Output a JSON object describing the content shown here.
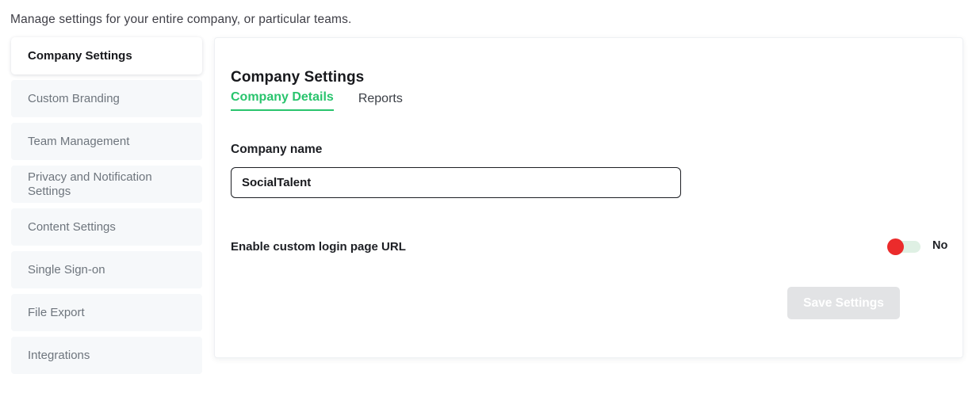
{
  "page": {
    "intro": "Manage settings for your entire company, or particular teams."
  },
  "sidebar": {
    "items": [
      {
        "label": "Company Settings",
        "active": true
      },
      {
        "label": "Custom Branding",
        "active": false
      },
      {
        "label": "Team Management",
        "active": false
      },
      {
        "label": "Privacy and Notification Settings",
        "active": false
      },
      {
        "label": "Content Settings",
        "active": false
      },
      {
        "label": "Single Sign-on",
        "active": false
      },
      {
        "label": "File Export",
        "active": false
      },
      {
        "label": "Integrations",
        "active": false
      }
    ]
  },
  "card": {
    "title": "Company Settings",
    "tabs": [
      {
        "label": "Company Details",
        "active": true
      },
      {
        "label": "Reports",
        "active": false
      }
    ],
    "company_name": {
      "label": "Company name",
      "value": "SocialTalent",
      "placeholder": "Company name"
    },
    "custom_login": {
      "label": "Enable custom login page URL",
      "state_label": "No",
      "enabled": false
    },
    "save_label": "Save Settings",
    "save_disabled": true
  },
  "colors": {
    "accent_green": "#29c46d",
    "toggle_off_knob": "#eb2b2b",
    "toggle_track": "#dff0e4",
    "nav_inactive_bg": "#f6f8fa",
    "save_disabled_bg": "#e2e3e5"
  }
}
